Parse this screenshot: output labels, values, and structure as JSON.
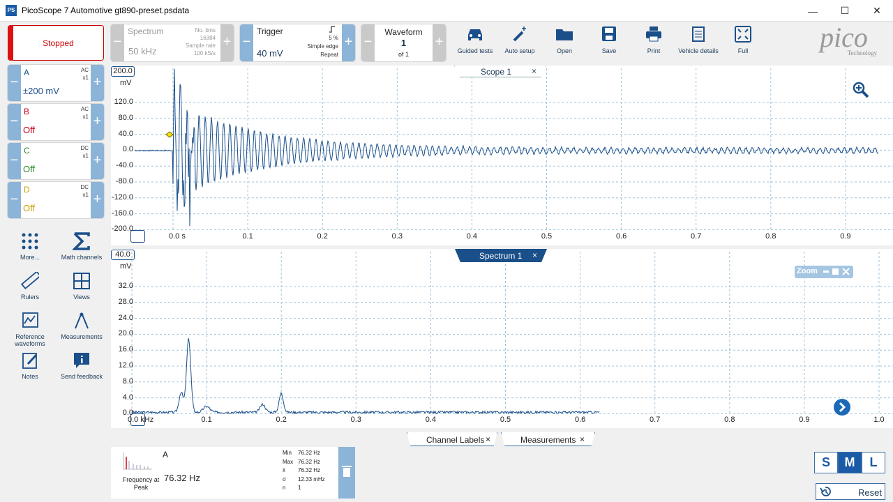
{
  "window": {
    "title": "PicoScope 7 Automotive gt890-preset.psdata",
    "icon": "PS",
    "min": "—",
    "max": "☐",
    "close": "✕"
  },
  "toolbar": {
    "run_label": "Stopped",
    "spectrum": {
      "label": "Spectrum",
      "value": "50 kHz",
      "bins_label": "No. bins",
      "bins": "16384",
      "rate_label": "Sample rate",
      "rate": "100 kS/s"
    },
    "trigger": {
      "label": "Trigger",
      "value": "40 mV",
      "pct": "5 %",
      "mode": "Simple edge",
      "repeat": "Repeat"
    },
    "waveform": {
      "label": "Waveform",
      "num": "1",
      "of": "of 1"
    },
    "tools": [
      {
        "label": "Guided tests",
        "icon": "car-icon"
      },
      {
        "label": "Auto setup",
        "icon": "wand-icon"
      },
      {
        "label": "Open",
        "icon": "folder-icon"
      },
      {
        "label": "Save",
        "icon": "save-icon"
      },
      {
        "label": "Print",
        "icon": "printer-icon"
      },
      {
        "label": "Vehicle details",
        "icon": "clipboard-icon"
      },
      {
        "label": "Full",
        "icon": "fullscreen-icon"
      }
    ],
    "logo": "pico",
    "logo_sub": "Technology",
    "minus": "−",
    "plus": "+"
  },
  "channels": [
    {
      "name": "A",
      "coupling": "AC",
      "probe": "x1",
      "range": "±200 mV",
      "color": "#1a4f8a"
    },
    {
      "name": "B",
      "coupling": "AC",
      "probe": "x1",
      "range": "Off",
      "color": "#d0021b"
    },
    {
      "name": "C",
      "coupling": "DC",
      "probe": "x1",
      "range": "Off",
      "color": "#2e8b2e"
    },
    {
      "name": "D",
      "coupling": "DC",
      "probe": "x1",
      "range": "Off",
      "color": "#c8a000"
    }
  ],
  "sidebar": [
    {
      "label": "More...",
      "icon": "more-icon"
    },
    {
      "label": "Math channels",
      "icon": "sigma-icon"
    },
    {
      "label": "Rulers",
      "icon": "ruler-icon"
    },
    {
      "label": "Views",
      "icon": "views-icon"
    },
    {
      "label": "Reference waveforms",
      "icon": "reference-icon"
    },
    {
      "label": "Measurements",
      "icon": "measurements-icon"
    },
    {
      "label": "Notes",
      "icon": "notes-icon"
    },
    {
      "label": "Send feedback",
      "icon": "feedback-icon"
    }
  ],
  "scope": {
    "tab": "Scope 1",
    "close": "×",
    "scale_box": "200.0",
    "unit": "mV",
    "y_ticks": [
      "120.0",
      "80.0",
      "40.0",
      "0.0",
      "-40.0",
      "-80.0",
      "-120.0",
      "-160.0",
      "-200.0"
    ],
    "x_ticks": [
      "0.0 s",
      "0.1",
      "0.2",
      "0.3",
      "0.4",
      "0.5",
      "0.6",
      "0.7",
      "0.8",
      "0.9"
    ]
  },
  "spectrum_view": {
    "tab": "Spectrum 1",
    "close": "×",
    "scale_box": "40.0",
    "unit": "mV",
    "y_ticks": [
      "32.0",
      "28.0",
      "24.0",
      "20.0",
      "16.0",
      "12.0",
      "8.0",
      "4.0",
      "0.0"
    ],
    "x_ticks": [
      "0.0 kHz",
      "0.1",
      "0.2",
      "0.3",
      "0.4",
      "0.5",
      "0.6",
      "0.7",
      "0.8",
      "0.9",
      "1.0"
    ],
    "zoom_label": "Zoom"
  },
  "bottom_tabs": [
    {
      "label": "Channel Labels",
      "close": "×"
    },
    {
      "label": "Measurements",
      "close": "×"
    }
  ],
  "measurement": {
    "channel": "A",
    "name": "Frequency at Peak",
    "value": "76.32 Hz",
    "stats": [
      {
        "k": "Min",
        "v": "76.32 Hz"
      },
      {
        "k": "Max",
        "v": "76.32 Hz"
      },
      {
        "k": "x̄",
        "v": "76.32 Hz"
      },
      {
        "k": "σ",
        "v": "12.33 mHz"
      },
      {
        "k": "n",
        "v": "1"
      }
    ]
  },
  "sizes": [
    "S",
    "M",
    "L"
  ],
  "reset_label": "Reset"
}
